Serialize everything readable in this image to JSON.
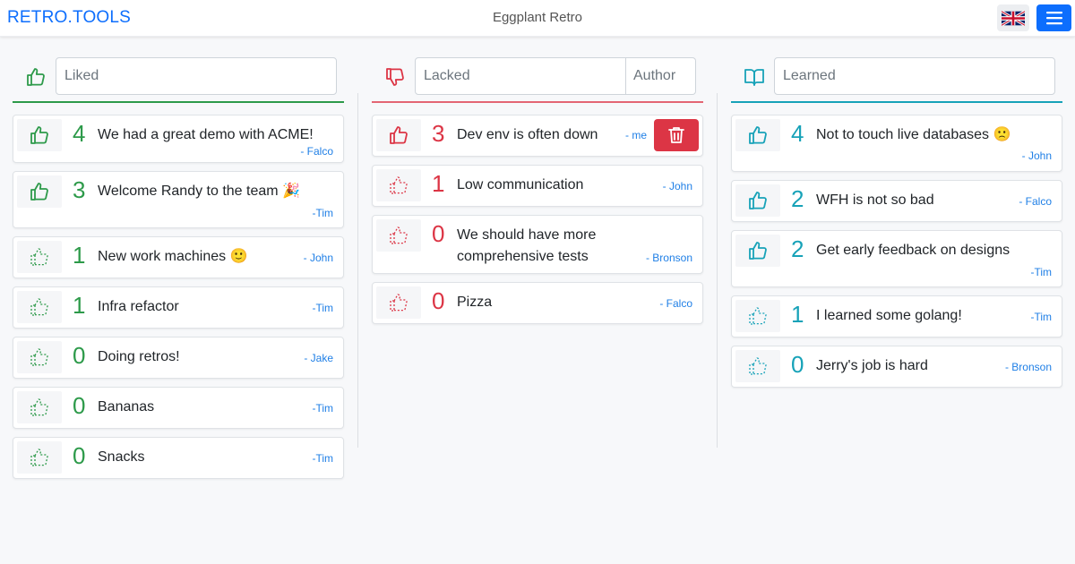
{
  "header": {
    "brand": "RETRO.TOOLS",
    "board_title": "Eggplant Retro",
    "language_icon": "uk-flag-icon",
    "menu_icon": "hamburger-menu-icon"
  },
  "colors": {
    "brand": "#0d6efd",
    "liked": "#2d9a4a",
    "lacked": "#dc3545",
    "learned": "#17a2b8",
    "author": "#1f7fe6"
  },
  "columns": [
    {
      "icon": "thumbs-up-icon",
      "placeholder": "Liked",
      "cards": [
        {
          "votes": "4",
          "text": "We had a great demo with ACME!",
          "author": "- Falco",
          "voted": true
        },
        {
          "votes": "3",
          "text": "Welcome Randy to the team 🎉",
          "author": "-Tim",
          "voted": true
        },
        {
          "votes": "1",
          "text": "New work machines 🙂",
          "author": "- John",
          "voted": false
        },
        {
          "votes": "1",
          "text": "Infra refactor",
          "author": "-Tim",
          "voted": false
        },
        {
          "votes": "0",
          "text": "Doing retros!",
          "author": "- Jake",
          "voted": false
        },
        {
          "votes": "0",
          "text": "Bananas",
          "author": "-Tim",
          "voted": false
        },
        {
          "votes": "0",
          "text": "Snacks",
          "author": "-Tim",
          "voted": false
        }
      ]
    },
    {
      "icon": "thumbs-down-icon",
      "placeholder": "Lacked",
      "author_placeholder": "Author",
      "cards": [
        {
          "votes": "3",
          "text": "Dev env is often down",
          "author": "- me",
          "voted": true,
          "deletable": true
        },
        {
          "votes": "1",
          "text": "Low communication",
          "author": "- John",
          "voted": false
        },
        {
          "votes": "0",
          "text": "We should have more comprehensive tests",
          "line1": "We should have more",
          "line2": "comprehensive tests",
          "author": "- Bronson",
          "voted": false
        },
        {
          "votes": "0",
          "text": "Pizza",
          "author": "- Falco",
          "voted": false
        }
      ]
    },
    {
      "icon": "book-open-icon",
      "placeholder": "Learned",
      "cards": [
        {
          "votes": "4",
          "text": "Not to touch live databases 🙁",
          "author": "- John",
          "voted": true
        },
        {
          "votes": "2",
          "text": "WFH is not so bad",
          "author": "- Falco",
          "voted": true
        },
        {
          "votes": "2",
          "text": "Get early feedback on designs",
          "author": "-Tim",
          "voted": true
        },
        {
          "votes": "1",
          "text": "I learned some golang!",
          "author": "-Tim",
          "voted": false
        },
        {
          "votes": "0",
          "text": "Jerry's job is hard",
          "author": "- Bronson",
          "voted": false
        }
      ]
    }
  ]
}
